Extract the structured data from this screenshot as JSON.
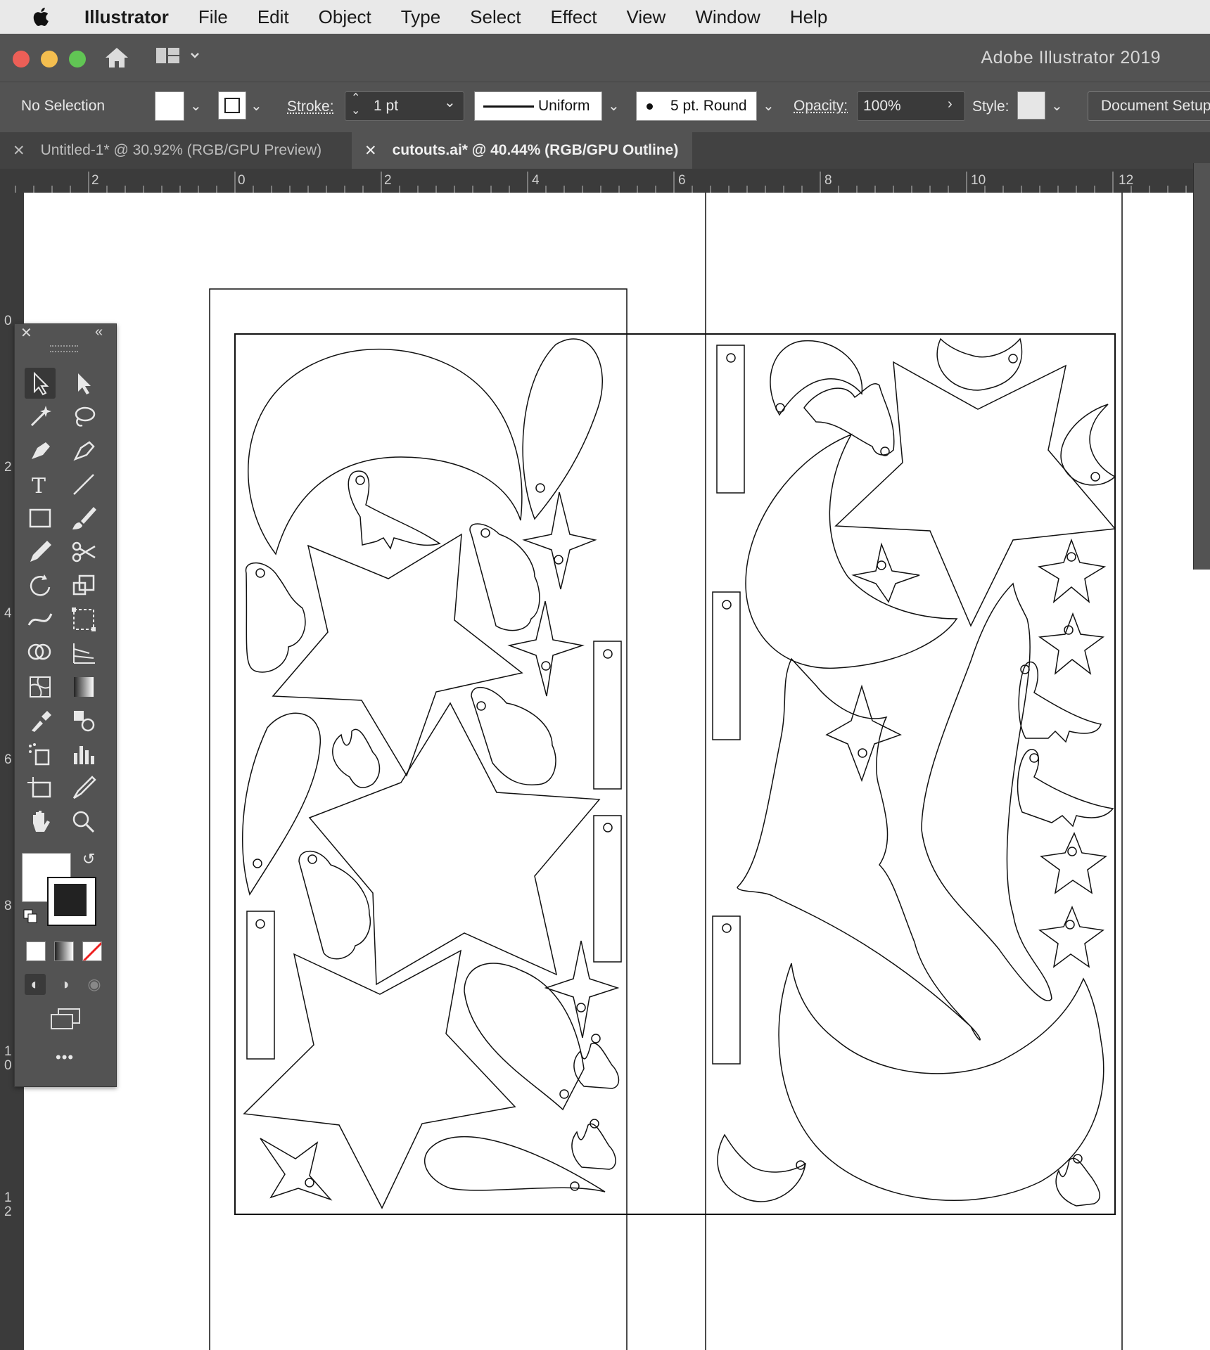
{
  "menubar": {
    "app_name": "Illustrator",
    "items": [
      "File",
      "Edit",
      "Object",
      "Type",
      "Select",
      "Effect",
      "View",
      "Window",
      "Help"
    ]
  },
  "window": {
    "title": "Adobe Illustrator 2019"
  },
  "control_bar": {
    "selection": "No Selection",
    "stroke_label": "Stroke:",
    "stroke_value": "1 pt",
    "profile": "Uniform",
    "brush": "5 pt. Round",
    "opacity_label": "Opacity:",
    "opacity_value": "100%",
    "style_label": "Style:",
    "doc_setup": "Document Setup"
  },
  "tabs": [
    {
      "label": "Untitled-1* @ 30.92% (RGB/GPU Preview)",
      "active": false
    },
    {
      "label": "cutouts.ai* @ 40.44% (RGB/GPU Outline)",
      "active": true
    }
  ],
  "rulers": {
    "h_labels": [
      "2",
      "0",
      "2",
      "4",
      "6",
      "8",
      "10",
      "12"
    ],
    "v_labels": [
      "0",
      "2",
      "4",
      "6",
      "8",
      "10",
      "12"
    ]
  },
  "tools_panel": {
    "more": "•••"
  },
  "icons": {
    "apple": "apple-logo-icon",
    "home": "home-icon",
    "workspace": "workspace-switcher-icon"
  },
  "colors": {
    "chrome": "#535353",
    "menubar": "#e9e9e9",
    "canvas": "#ffffff",
    "close": "#ec5f57",
    "minimize": "#f4be4f",
    "zoom": "#61c554"
  }
}
